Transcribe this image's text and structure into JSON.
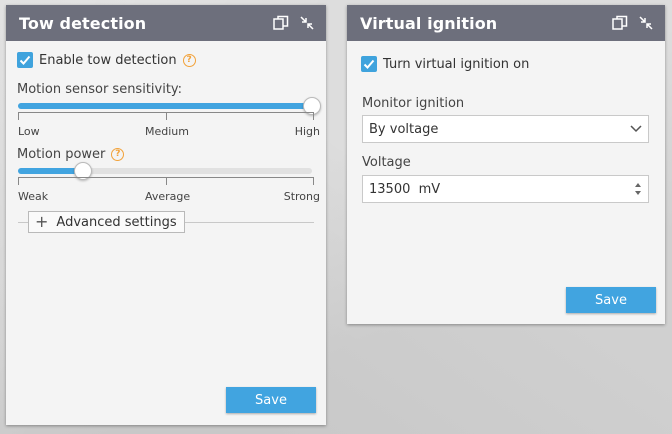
{
  "tow": {
    "title": "Tow detection",
    "enable_label": "Enable tow detection",
    "enable_checked": true,
    "sensitivity_label": "Motion sensor sensitivity:",
    "sensitivity_level": 1.0,
    "sensitivity_scale": [
      "Low",
      "Medium",
      "High"
    ],
    "power_label": "Motion power",
    "power_level": 0.22,
    "power_scale": [
      "Weak",
      "Average",
      "Strong"
    ],
    "advanced_label": "Advanced settings",
    "save_label": "Save"
  },
  "ignition": {
    "title": "Virtual ignition",
    "toggle_label": "Turn virtual ignition on",
    "toggle_checked": true,
    "monitor_label": "Monitor ignition",
    "monitor_value": "By voltage",
    "voltage_label": "Voltage",
    "voltage_value": "13500  mV",
    "save_label": "Save"
  },
  "icons": {
    "copy": "copy-icon",
    "collapse": "collapse-icon",
    "help": "help-icon",
    "check": "check-icon",
    "chevron": "chevron-down-icon",
    "spinner": "stepper-icon",
    "plus": "plus-icon"
  },
  "colors": {
    "header": "#6d6f7c",
    "accent": "#41a4e0",
    "help": "#f2a23a"
  }
}
